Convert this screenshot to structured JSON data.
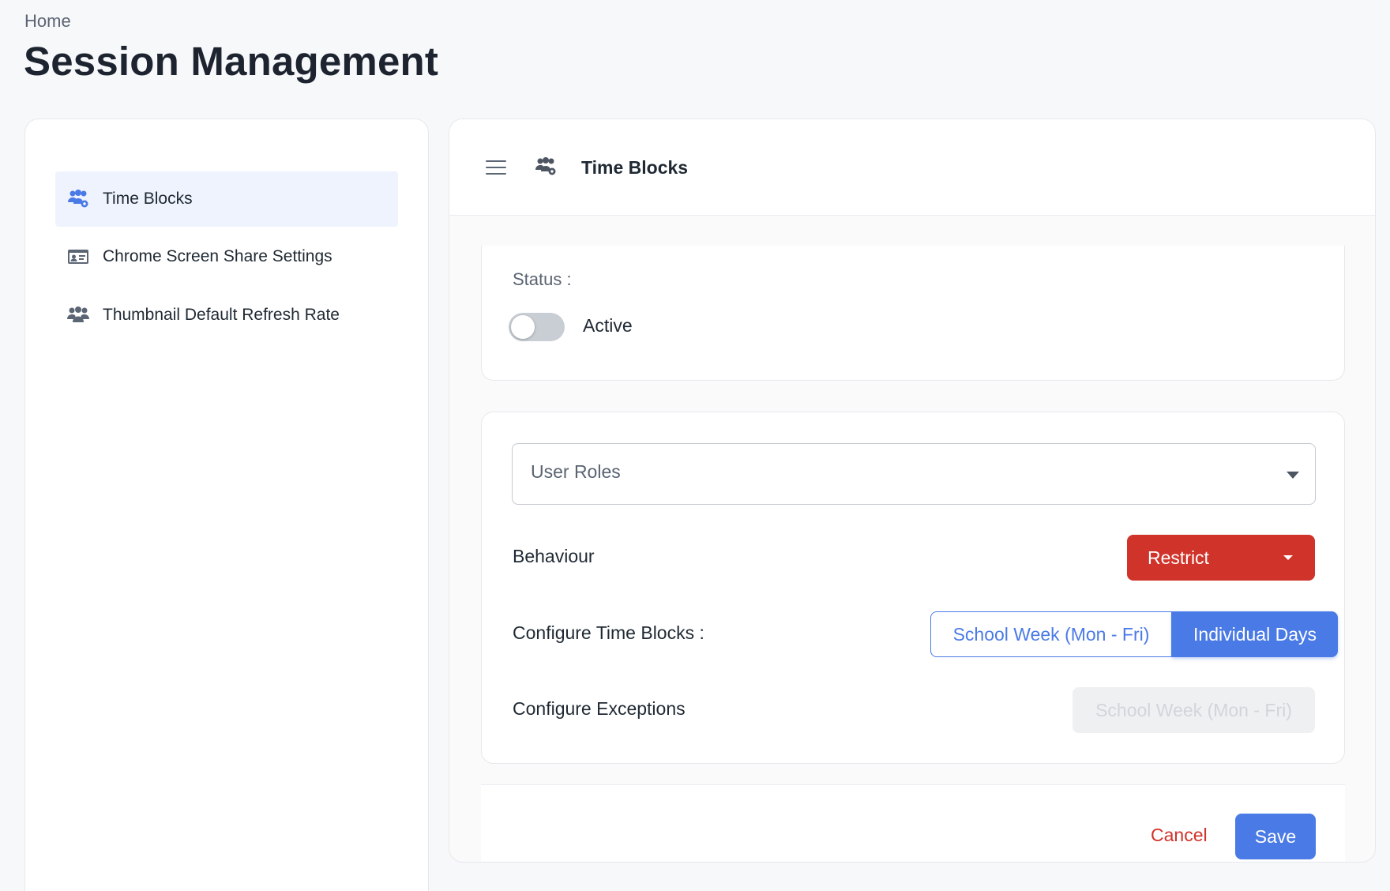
{
  "breadcrumb": "Home",
  "page_title": "Session Management",
  "sidebar": {
    "items": [
      {
        "label": "Time Blocks",
        "icon": "users-gear-icon",
        "active": true
      },
      {
        "label": "Chrome Screen Share Settings",
        "icon": "id-card-icon",
        "active": false
      },
      {
        "label": "Thumbnail Default Refresh Rate",
        "icon": "users-icon",
        "active": false
      }
    ]
  },
  "main": {
    "header": {
      "title": "Time Blocks",
      "icon": "users-gear-icon",
      "menu_icon": "hamburger-icon"
    },
    "status": {
      "label": "Status :",
      "toggle_label": "Active",
      "toggle_on": false
    },
    "config": {
      "user_roles_placeholder": "User Roles",
      "behaviour_label": "Behaviour",
      "behaviour_value": "Restrict",
      "time_blocks_label": "Configure Time Blocks :",
      "time_blocks_options": [
        "School Week (Mon - Fri)",
        "Individual Days"
      ],
      "time_blocks_selected": "Individual Days",
      "exceptions_label": "Configure Exceptions",
      "exceptions_button": "School Week (Mon - Fri)"
    },
    "footer": {
      "cancel_label": "Cancel",
      "save_label": "Save"
    }
  },
  "colors": {
    "primary": "#4a7ae6",
    "danger": "#d0332a",
    "active_nav_bg": "#eff3fd"
  }
}
